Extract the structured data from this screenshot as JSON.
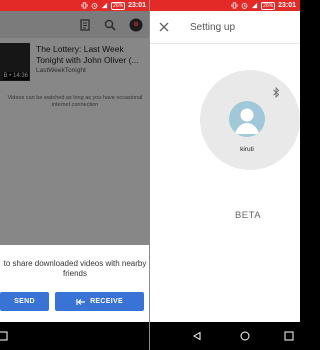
{
  "status_bar": {
    "left": {
      "battery": "26%",
      "time": "23:01"
    },
    "right": {
      "battery": "26%",
      "time": "23:01"
    }
  },
  "left_app": {
    "video": {
      "title": "The Lottery: Last Week Tonight with John Oliver (...",
      "channel": "LastWeekTonight",
      "duration": "B • 14:36"
    },
    "info_text": "Videos can be watched as long as you have occasional internet connection",
    "share_sheet": {
      "message": "to share downloaded videos with nearby friends",
      "send_label": "SEND",
      "receive_label": "RECEIVE"
    }
  },
  "right_app": {
    "title": "Setting up",
    "device_name": "kiruti",
    "beta_label": "BETA"
  },
  "colors": {
    "status_bar": "#e32a27",
    "accent_button": "#3a73d6",
    "avatar": "#a0c8d8",
    "circle": "#e9e9e9"
  },
  "icons": {
    "toolbar": [
      "library-icon",
      "search-icon",
      "account-icon"
    ],
    "status": [
      "vibrate-icon",
      "alarm-icon",
      "signal-icon",
      "battery-icon"
    ],
    "navigation": [
      "back-icon",
      "home-icon",
      "recents-icon"
    ],
    "right": [
      "close-icon",
      "bluetooth-icon",
      "person-icon"
    ]
  }
}
